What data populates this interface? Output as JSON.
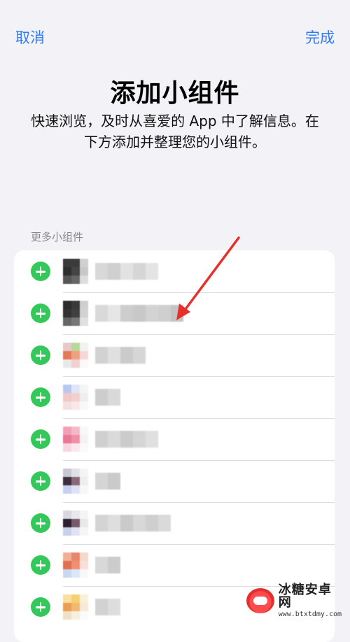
{
  "nav": {
    "cancel_label": "取消",
    "done_label": "完成",
    "accent": "#2f7bf6"
  },
  "header": {
    "title": "添加小组件",
    "subtitle": "快速浏览，及时从喜爱的 App 中了解信息。在下方添加并整理您的小组件。"
  },
  "section": {
    "label": "更多小组件"
  },
  "list": {
    "add_icon": "plus-circle-icon",
    "add_color": "#34c759",
    "rows": [
      {
        "icon_colors": [
          "#3a3a3a",
          "#3b3b3b",
          "#d0d0d0",
          "#2e2e2e",
          "#444",
          "#c8c8c8",
          "#555",
          "#666",
          "#ddd"
        ],
        "name_colors": [
          "#d8d8d8",
          "#cfcfcf",
          "#e2e2e2",
          "#d6d6d6",
          "#e4e4e4"
        ]
      },
      {
        "icon_colors": [
          "#2c2c2c",
          "#3a3a3a",
          "#cfcfcf",
          "#333",
          "#404040",
          "#d2d2d2",
          "#666",
          "#777",
          "#e0e0e0"
        ],
        "name_colors": [
          "#d9d9d9",
          "#e6e6e6",
          "#cdcdcd",
          "#c8c8c8",
          "#d3d3d3",
          "#cfcfcf",
          "#c4c4c4"
        ]
      },
      {
        "icon_colors": [
          "#e8c8c8",
          "#b8d89a",
          "#f2f2f2",
          "#e07a5a",
          "#f0a080",
          "#f5d8d8",
          "#e9e9e9",
          "#f0d0d0",
          "#fafafa"
        ],
        "name_colors": [
          "#d2d2d2",
          "#e0e0e0",
          "#cbcbcb",
          "#d6d6d6"
        ]
      },
      {
        "icon_colors": [
          "#b8c8f0",
          "#dfe6f6",
          "#f5f5f5",
          "#f0c8c8",
          "#f2d0d0",
          "#eee",
          "#f3e0e0",
          "#fae8e8",
          "#f8f8f8"
        ],
        "name_colors": [
          "#cdcdcd",
          "#d9d9d9"
        ]
      },
      {
        "icon_colors": [
          "#f0a0b8",
          "#f5b8c8",
          "#f8f8f8",
          "#e87898",
          "#f090a8",
          "#f3f3f3",
          "#f8d8e0",
          "#fbe8ee",
          "#fafafa"
        ],
        "name_colors": [
          "#d0d0d0",
          "#dadada",
          "#cbcbcb",
          "#d5d5d5",
          "#e0e0e0"
        ]
      },
      {
        "icon_colors": [
          "#c8c8d0",
          "#e0e0e6",
          "#f4f4f4",
          "#3a3040",
          "#8a6a7a",
          "#eee",
          "#c8d0f0",
          "#dde2f5",
          "#f7f7f7"
        ],
        "name_colors": [
          "#d5d5d5",
          "#cacaca"
        ]
      },
      {
        "icon_colors": [
          "#d8d8e0",
          "#e8e8ee",
          "#f5f5f5",
          "#2a2030",
          "#7a5a6a",
          "#e8e8e8",
          "#c8d0e8",
          "#e0e4f2",
          "#f6f6f6"
        ],
        "name_colors": [
          "#d4d4d4",
          "#dedede",
          "#cacaca",
          "#d8d8d8",
          "#cfcfcf",
          "#dadada"
        ]
      },
      {
        "icon_colors": [
          "#f0b098",
          "#e8886a",
          "#f5d8cc",
          "#e07050",
          "#f09070",
          "#f8e0d8",
          "#c8d8f0",
          "#dde6f8",
          "#f8f8f8"
        ],
        "name_colors": [
          "#d8d8d8",
          "#cccccc"
        ]
      },
      {
        "icon_colors": [
          "#f8e0a0",
          "#f5d070",
          "#f8f0d8",
          "#e8a050",
          "#f0b870",
          "#f8e8d8",
          "#f0e0c8",
          "#f8eee0",
          "#fafafa"
        ],
        "name_colors": [
          "#d2d2d2",
          "#dddddd"
        ]
      }
    ]
  },
  "watermark": {
    "main": "冰糖安卓网",
    "url": "www.btxtdmy.com"
  }
}
